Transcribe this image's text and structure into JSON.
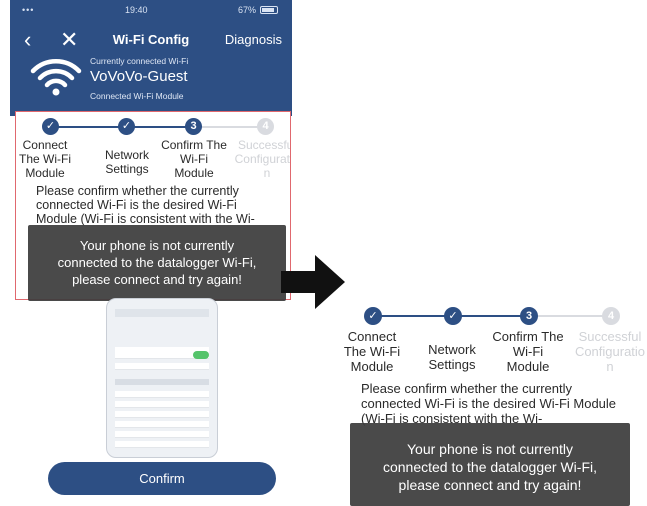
{
  "status_bar": {
    "carrier": "•••",
    "time": "19:40",
    "battery": "67%"
  },
  "header": {
    "title": "Wi-Fi Config",
    "diagnosis_label": "Diagnosis",
    "back_icon": "‹",
    "close_icon": "✕",
    "connection_label": "Currently connected Wi-Fi",
    "ssid": "VoVoVo-Guest",
    "module_label": "Connected Wi-Fi Module"
  },
  "steps": [
    {
      "number": "1",
      "label": "Connect The Wi-Fi Module",
      "lines": [
        "Connect",
        "The Wi-Fi",
        "Module"
      ],
      "state": "done"
    },
    {
      "number": "2",
      "label": "Network Settings",
      "lines": [
        "Network",
        "Settings"
      ],
      "state": "done"
    },
    {
      "number": "3",
      "label": "Confirm The Wi-Fi Module",
      "lines": [
        "Confirm The",
        "Wi-Fi",
        "Module"
      ],
      "state": "current"
    },
    {
      "number": "4",
      "label": "Successful Configuration",
      "lines": [
        "Successful",
        "Configuratio",
        "n"
      ],
      "state": "pending"
    }
  ],
  "confirm_message": "Please confirm whether the currently connected Wi-Fi is the desired Wi-Fi Module (Wi-Fi is consistent with the Wi-",
  "toast": {
    "line1": "Your phone is not currently",
    "line2": "connected to the datalogger Wi-Fi,",
    "line3": "please connect and try again!"
  },
  "confirm_button_label": "Confirm",
  "colors": {
    "header_bg": "#2d4f84",
    "step_active": "#2d4f84",
    "step_pending": "#d9dbe0",
    "highlight_border": "#e0686e",
    "toast_bg": "#3c3c3c"
  }
}
